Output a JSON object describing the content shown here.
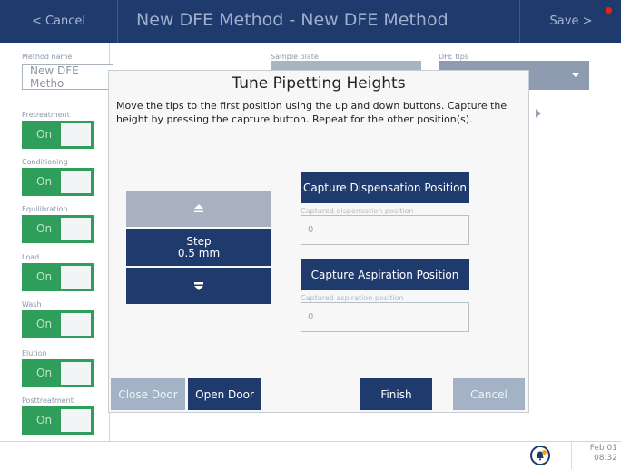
{
  "header": {
    "cancel_label": "< Cancel",
    "title": "New DFE Method - New DFE Method",
    "save_label": "Save >"
  },
  "form": {
    "method_name_label": "Method name",
    "method_name_value": "New DFE Metho",
    "sample_plate_label": "Sample plate",
    "dfe_tips_label": "DFE tips"
  },
  "toggles": [
    {
      "label": "Pretreatment",
      "state": "On"
    },
    {
      "label": "Conditioning",
      "state": "On"
    },
    {
      "label": "Equilibration",
      "state": "On"
    },
    {
      "label": "Load",
      "state": "On"
    },
    {
      "label": "Wash",
      "state": "On"
    },
    {
      "label": "Elution",
      "state": "On"
    },
    {
      "label": "Posttreatment",
      "state": "On"
    }
  ],
  "modal": {
    "title": "Tune Pipetting Heights",
    "description": "Move the tips to the first position using the up and down buttons. Capture the height by pressing the capture button. Repeat for the other position(s).",
    "step_label": "Step",
    "step_value": "0.5 mm",
    "capture_dispensation_label": "Capture Dispensation Position",
    "captured_dispensation_label": "Captured dispensation position",
    "captured_dispensation_value": "0",
    "capture_aspiration_label": "Capture Aspiration Position",
    "captured_aspiration_label": "Captured aspiration position",
    "captured_aspiration_value": "0",
    "close_door_label": "Close Door",
    "open_door_label": "Open Door",
    "finish_label": "Finish",
    "cancel_label": "Cancel"
  },
  "footer": {
    "date": "Feb 01",
    "time": "08:32"
  },
  "colors": {
    "navy": "#1f3b6e",
    "green": "#2f9e5b",
    "alert_red": "#e2231a"
  },
  "icons": {
    "up": "arrow-up-icon",
    "down": "arrow-down-icon",
    "bell": "bell-icon"
  }
}
